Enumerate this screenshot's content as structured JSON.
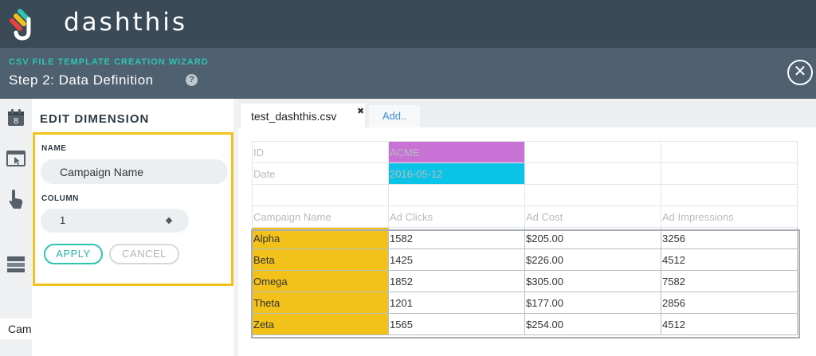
{
  "app": {
    "logo_text": "dashthis"
  },
  "wizard": {
    "kicker": "CSV FILE TEMPLATE CREATION WIZARD",
    "title": "Step 2: Data Definition",
    "help_glyph": "?",
    "close_glyph": "✕"
  },
  "rail": {
    "partial_label": "Cam"
  },
  "edit": {
    "title": "EDIT DIMENSION",
    "name_label": "NAME",
    "name_value": "Campaign Name",
    "column_label": "COLUMN",
    "column_value": "1",
    "apply_label": "APPLY",
    "cancel_label": "CANCEL",
    "highlight_color": "#f2c21b"
  },
  "tabs": {
    "active_label": "test_dashthis.csv",
    "close_glyph": "✖",
    "add_label": "Add.."
  },
  "sheet": {
    "meta_rows": [
      {
        "label": "ID",
        "value": "ACME"
      },
      {
        "label": "Date",
        "value": "2016-05-12"
      }
    ],
    "headers": [
      "Campaign Name",
      "Ad Clicks",
      "Ad Cost",
      "Ad Impressions"
    ],
    "rows": [
      [
        "Alpha",
        "1582",
        "$205.00",
        "3256"
      ],
      [
        "Beta",
        "1425",
        "$226.00",
        "4512"
      ],
      [
        "Omega",
        "1852",
        "$305.00",
        "7582"
      ],
      [
        "Theta",
        "1201",
        "$177.00",
        "2856"
      ],
      [
        "Zeta",
        "1565",
        "$254.00",
        "4512"
      ]
    ],
    "colors": {
      "id": "#c772d4",
      "date": "#0bc3e6",
      "dimension": "#f2c21b"
    }
  }
}
